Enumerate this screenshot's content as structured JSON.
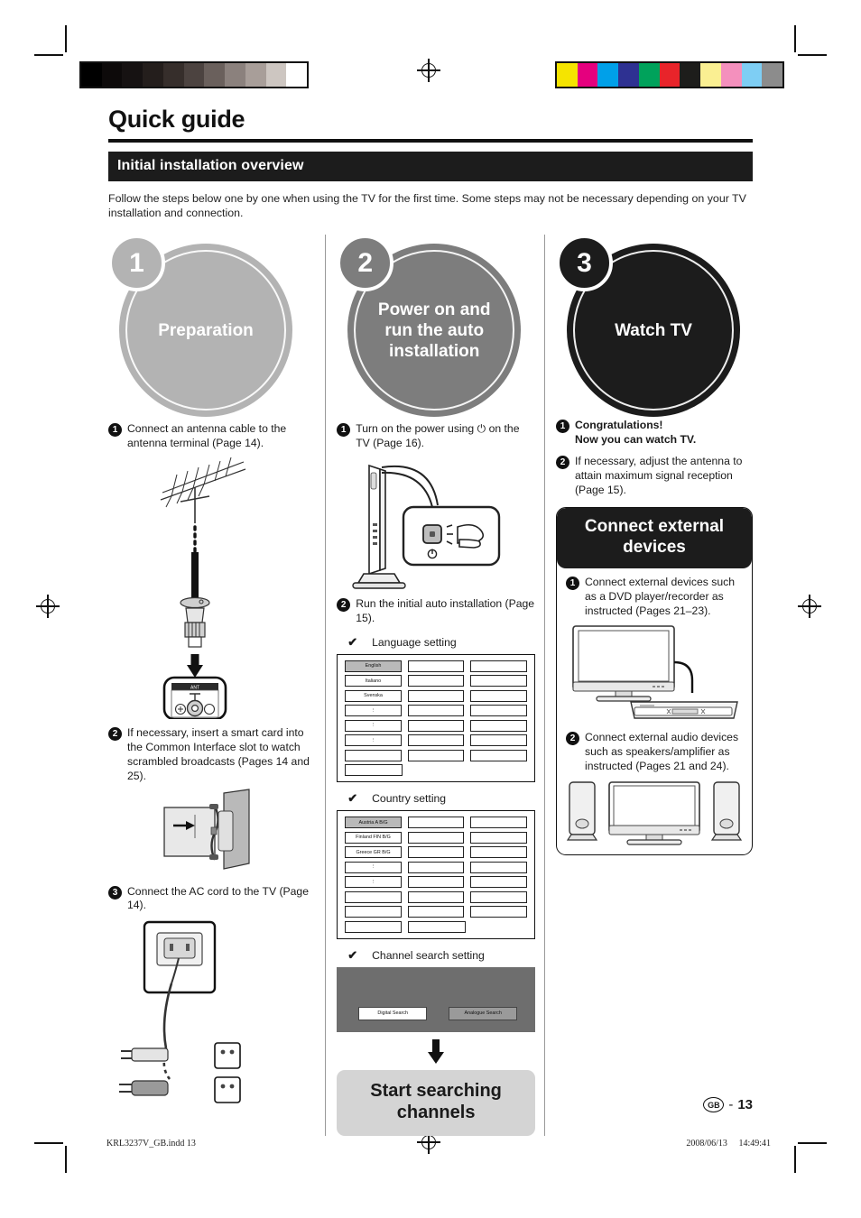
{
  "document": {
    "title": "Quick guide",
    "section_heading": "Initial installation overview",
    "intro": "Follow the steps below one by one when using the TV for the first time. Some steps may not be necessary depending on your TV installation and connection."
  },
  "steps": [
    {
      "number": "1",
      "circle_label": "Preparation",
      "circle_color": "#b3b3b3",
      "items": [
        {
          "marker": "1",
          "text": "Connect an antenna cable to the antenna terminal (Page 14)."
        },
        {
          "marker": "2",
          "text": "If necessary, insert a smart card into the Common Interface slot to watch scrambled broadcasts (Pages 14 and 25)."
        },
        {
          "marker": "3",
          "text": "Connect the AC cord to the TV (Page 14)."
        }
      ],
      "illustrations": [
        {
          "name": "antenna-cable-illustration",
          "label": "ANT"
        },
        {
          "name": "smart-card-illustration",
          "label": ""
        },
        {
          "name": "ac-cord-illustration",
          "label": ""
        }
      ]
    },
    {
      "number": "2",
      "circle_label": "Power on and run the auto installation",
      "circle_color": "#7d7d7d",
      "items": [
        {
          "marker": "1",
          "text": "Turn on the power using ⏻ on the TV (Page 16)."
        },
        {
          "marker": "2",
          "text": "Run the initial auto installation (Page 15)."
        }
      ],
      "sub_settings": [
        {
          "tick": "✔",
          "label": "Language setting"
        },
        {
          "tick": "✔",
          "label": "Country setting"
        },
        {
          "tick": "✔",
          "label": "Channel search setting"
        }
      ],
      "language_table": {
        "selected": "English",
        "rows": [
          "English",
          "Italiano",
          "Svenska",
          "⋮",
          "⋮",
          "⋮",
          "",
          ""
        ]
      },
      "country_table": {
        "selected": "Austria    A    B/G",
        "rows": [
          "Austria    A    B/G",
          "Finland   FIN  B/G",
          "Greece    GR   B/G",
          "⋮",
          "⋮",
          "",
          "",
          ""
        ]
      },
      "channel_search": {
        "digital_button": "Digital Search",
        "analogue_button": "Analogue Search"
      },
      "start_box": "Start searching channels"
    },
    {
      "number": "3",
      "circle_label": "Watch TV",
      "circle_color": "#1c1c1c",
      "items": [
        {
          "marker": "1",
          "text": "Congratulations!\nNow you can watch TV.",
          "bold": true
        },
        {
          "marker": "2",
          "text": "If necessary, adjust the antenna to attain maximum signal reception (Page 15)."
        }
      ],
      "connect_panel": {
        "heading": "Connect external devices",
        "items": [
          {
            "marker": "1",
            "text": "Connect external devices such as a DVD player/recorder as instructed (Pages 21–23)."
          },
          {
            "marker": "2",
            "text": "Connect external audio devices such as speakers/amplifier as instructed (Pages 21 and 24)."
          }
        ]
      }
    }
  ],
  "footer": {
    "region_code": "GB",
    "dash": "-",
    "page_number": "13",
    "file_name": "KRL3237V_GB.indd   13",
    "date": "2008/06/13",
    "time": "14:49:41"
  },
  "calibration": {
    "grayscale": [
      "#000000",
      "#0d0a0a",
      "#161212",
      "#241e1c",
      "#362e2b",
      "#4c4340",
      "#6a605c",
      "#8b817d",
      "#a89e99",
      "#cdc6c1",
      "#ffffff"
    ],
    "colors": [
      "#f5e400",
      "#e5007e",
      "#00a0e9",
      "#2e3192",
      "#00a25b",
      "#e8242a",
      "#1d1d1b",
      "#faef92",
      "#f490bd",
      "#7ecef4",
      "#8c8c8c"
    ]
  }
}
